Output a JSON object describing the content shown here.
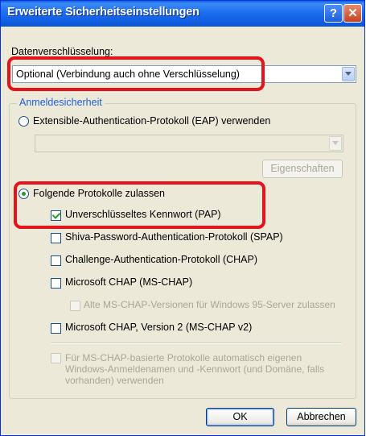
{
  "window": {
    "title": "Erweiterte Sicherheitseinstellungen",
    "help_glyph": "?",
    "close_glyph": "✕"
  },
  "encryption": {
    "label": "Datenverschlüsselung:",
    "selected": "Optional (Verbindung auch ohne Verschlüsselung)"
  },
  "logon_security": {
    "legend": "Anmeldesicherheit",
    "eap_radio": "Extensible-Authentication-Protokoll (EAP) verwenden",
    "eap_properties_button": "Eigenschaften",
    "allow_protocols_radio": "Folgende Protokolle zulassen",
    "protocols": {
      "pap": "Unverschlüsseltes Kennwort (PAP)",
      "spap": "Shiva-Password-Authentication-Protokoll (SPAP)",
      "chap": "Challenge-Authentication-Protokoll (CHAP)",
      "mschap": "Microsoft CHAP (MS-CHAP)",
      "mschap_legacy": "Alte MS-CHAP-Versionen für Windows 95-Server zulassen",
      "mschap_v2": "Microsoft CHAP, Version 2 (MS-CHAP v2)"
    },
    "auto_logon": "Für MS-CHAP-basierte Protokolle automatisch eigenen Windows-Anmeldenamen und -Kennwort (und Domäne, falls vorhanden) verwenden"
  },
  "buttons": {
    "ok": "OK",
    "cancel": "Abbrechen"
  },
  "state": {
    "eap_selected": false,
    "allow_protocols_selected": true,
    "pap_checked": true,
    "spap_checked": false,
    "chap_checked": false,
    "mschap_checked": false,
    "mschap_legacy_checked": false,
    "mschap_v2_checked": false,
    "auto_logon_checked": false
  },
  "colors": {
    "titlebar": "#0a55d8",
    "dialog_bg": "#ece9d8",
    "highlight": "#e4141c",
    "legend_text": "#2060d8",
    "check_mark": "#21a121"
  }
}
